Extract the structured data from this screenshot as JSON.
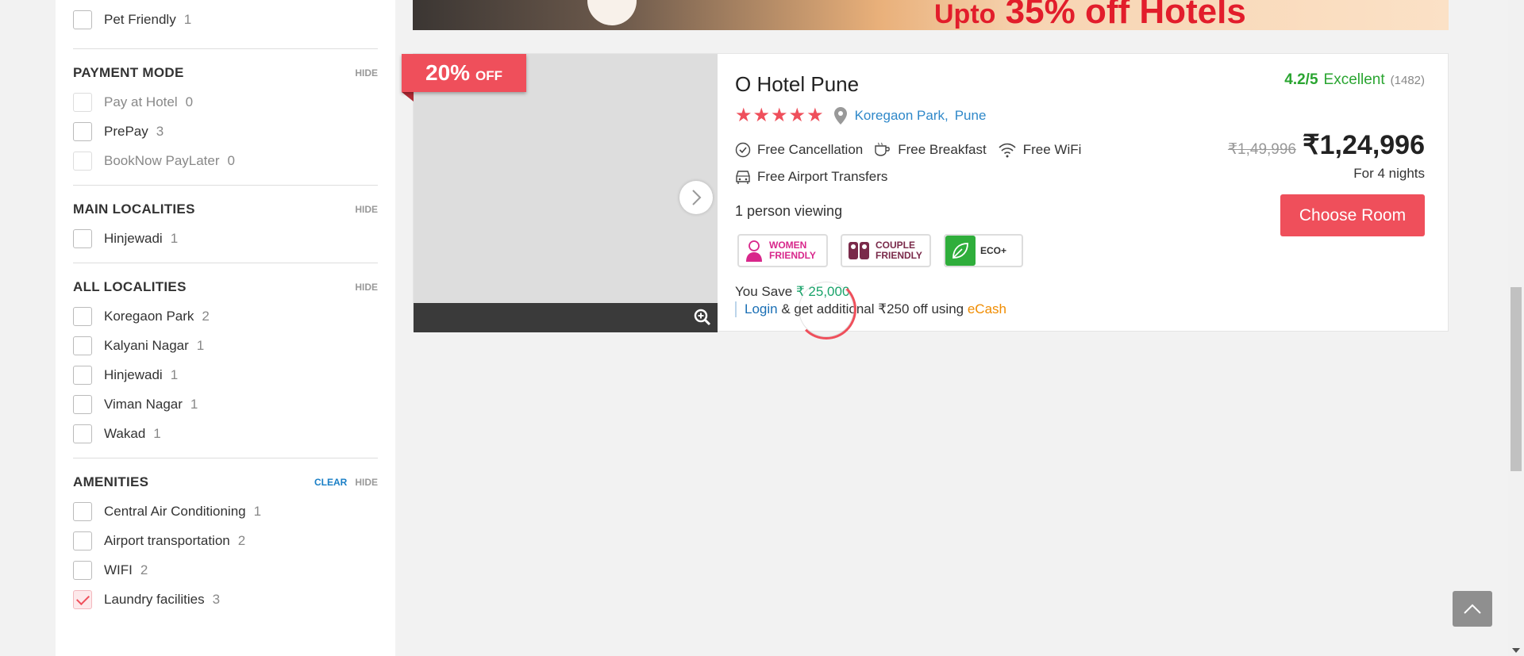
{
  "sidebar": {
    "top_item": {
      "label": "Pet Friendly",
      "count": "1"
    },
    "payment_mode": {
      "title": "PAYMENT MODE",
      "hide_label": "HIDE",
      "items": [
        {
          "label": "Pay at Hotel",
          "count": "0",
          "disabled": true
        },
        {
          "label": "PrePay",
          "count": "3",
          "disabled": false
        },
        {
          "label": "BookNow PayLater",
          "count": "0",
          "disabled": true
        }
      ]
    },
    "main_localities": {
      "title": "MAIN LOCALITIES",
      "hide_label": "HIDE",
      "items": [
        {
          "label": "Hinjewadi",
          "count": "1"
        }
      ]
    },
    "all_localities": {
      "title": "ALL LOCALITIES",
      "hide_label": "HIDE",
      "items": [
        {
          "label": "Koregaon Park",
          "count": "2"
        },
        {
          "label": "Kalyani Nagar",
          "count": "1"
        },
        {
          "label": "Hinjewadi",
          "count": "1"
        },
        {
          "label": "Viman Nagar",
          "count": "1"
        },
        {
          "label": "Wakad",
          "count": "1"
        }
      ]
    },
    "amenities": {
      "title": "AMENITIES",
      "clear_label": "CLEAR",
      "hide_label": "HIDE",
      "items": [
        {
          "label": "Central Air Conditioning",
          "count": "1",
          "checked": false
        },
        {
          "label": "Airport transportation",
          "count": "2",
          "checked": false
        },
        {
          "label": "WIFI",
          "count": "2",
          "checked": false
        },
        {
          "label": "Laundry facilities",
          "count": "3",
          "checked": true
        }
      ]
    }
  },
  "banner": {
    "text_prefix": "Upto",
    "text_main": "35% off Hotels"
  },
  "hotel": {
    "discount_pct": "20%",
    "discount_suffix": "OFF",
    "name": "O Hotel Pune",
    "stars": "★★★★★",
    "star_rating": 5,
    "locality": "Koregaon Park,",
    "city": "Pune",
    "amenities": [
      {
        "icon": "check-circle-icon",
        "label": "Free Cancellation"
      },
      {
        "icon": "coffee-cup-icon",
        "label": "Free Breakfast"
      },
      {
        "icon": "wifi-icon",
        "label": "Free WiFi"
      },
      {
        "icon": "car-icon",
        "label": "Free Airport Transfers"
      }
    ],
    "viewing": "1 person viewing",
    "badges": {
      "women_line1": "WOMEN",
      "women_line2": "FRIENDLY",
      "couple_line1": "COUPLE",
      "couple_line2": "FRIENDLY",
      "eco": "ECO+"
    },
    "save_prefix": "You Save ",
    "save_amount": "₹ 25,000",
    "login_label": "Login",
    "login_middle": " & get additional ₹250 off using ",
    "ecash_label": "eCash",
    "rating_score": "4.2/5",
    "rating_word": "Excellent",
    "rating_count": "(1482)",
    "old_price": "₹1,49,996",
    "new_price": "₹1,24,996",
    "nights": "For 4 nights",
    "choose_label": "Choose Room"
  },
  "colors": {
    "accent": "#ef4f5b",
    "link": "#2f88c9",
    "rating": "#2aa531",
    "ecash": "#f08c00"
  }
}
